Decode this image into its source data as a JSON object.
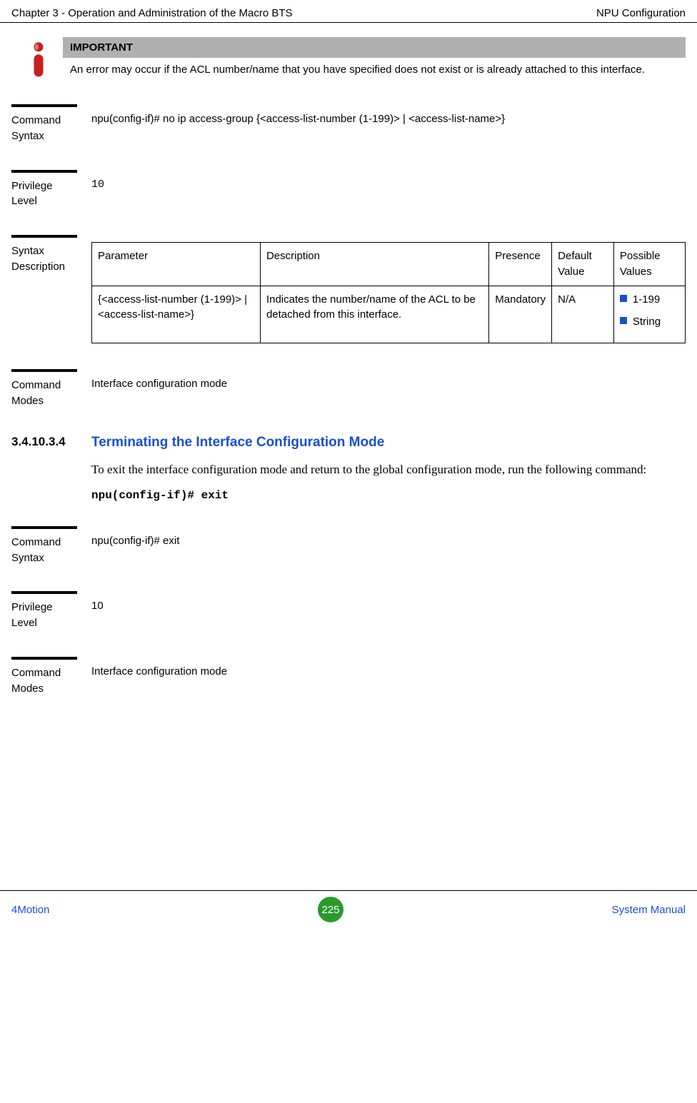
{
  "header": {
    "left": "Chapter 3 - Operation and Administration of the Macro BTS",
    "right": "NPU Configuration"
  },
  "important": {
    "title": "IMPORTANT",
    "text": "An error may occur if the ACL number/name that you have specified does not exist or is already attached to this interface."
  },
  "block1": {
    "syntax_label": "Command Syntax",
    "syntax_value": "npu(config-if)# no ip access-group {<access-list-number (1-199)> | <access-list-name>}",
    "priv_label": "Privilege Level",
    "priv_value": "10",
    "desc_label": "Syntax Description",
    "table": {
      "headers": {
        "param": "Parameter",
        "desc": "Description",
        "presence": "Presence",
        "default": "Default Value",
        "possible": "Possible Values"
      },
      "row": {
        "param": "{<access-list-number (1-199)> | <access-list-name>}",
        "desc": "Indicates the number/name of the ACL to be detached from this interface.",
        "presence": "Mandatory",
        "default": "N/A",
        "possible1": "1-199",
        "possible2": "String"
      }
    },
    "modes_label": "Command Modes",
    "modes_value": "Interface configuration mode"
  },
  "section": {
    "num": "3.4.10.3.4",
    "title": "Terminating the Interface Configuration Mode",
    "body": "To exit the interface configuration mode and return to the global configuration mode, run the following command:",
    "code": "npu(config-if)# exit"
  },
  "block2": {
    "syntax_label": "Command Syntax",
    "syntax_value": "npu(config-if)# exit",
    "priv_label": "Privilege Level",
    "priv_value": "10",
    "modes_label": "Command Modes",
    "modes_value": "Interface configuration mode"
  },
  "footer": {
    "left": "4Motion",
    "page": "225",
    "right": "System Manual"
  }
}
